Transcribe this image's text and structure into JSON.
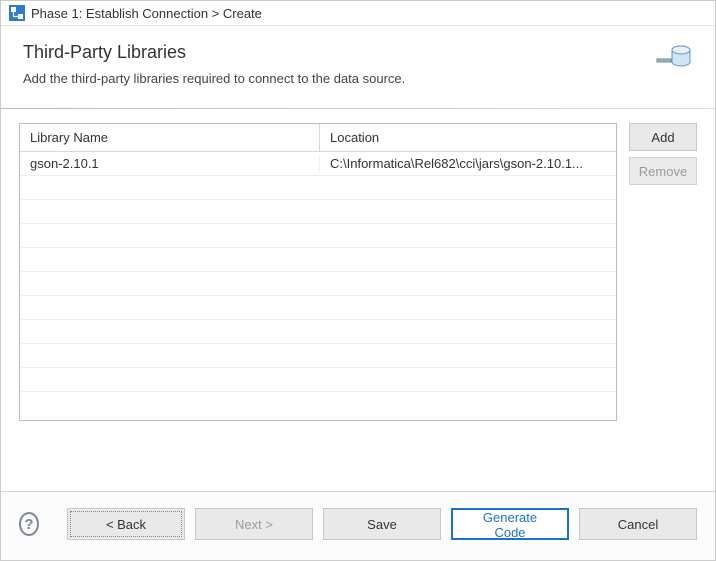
{
  "titlebar": {
    "title": "Phase 1: Establish Connection > Create"
  },
  "header": {
    "heading": "Third-Party Libraries",
    "subtitle": "Add the third-party libraries required to connect to the data source."
  },
  "table": {
    "col_name": "Library Name",
    "col_location": "Location",
    "rows": [
      {
        "name": "gson-2.10.1",
        "location": "C:\\Informatica\\Rel682\\cci\\jars\\gson-2.10.1..."
      }
    ]
  },
  "side": {
    "add": "Add",
    "remove": "Remove"
  },
  "footer": {
    "back": "< Back",
    "next": "Next >",
    "save": "Save",
    "generate": "Generate Code",
    "cancel": "Cancel"
  }
}
